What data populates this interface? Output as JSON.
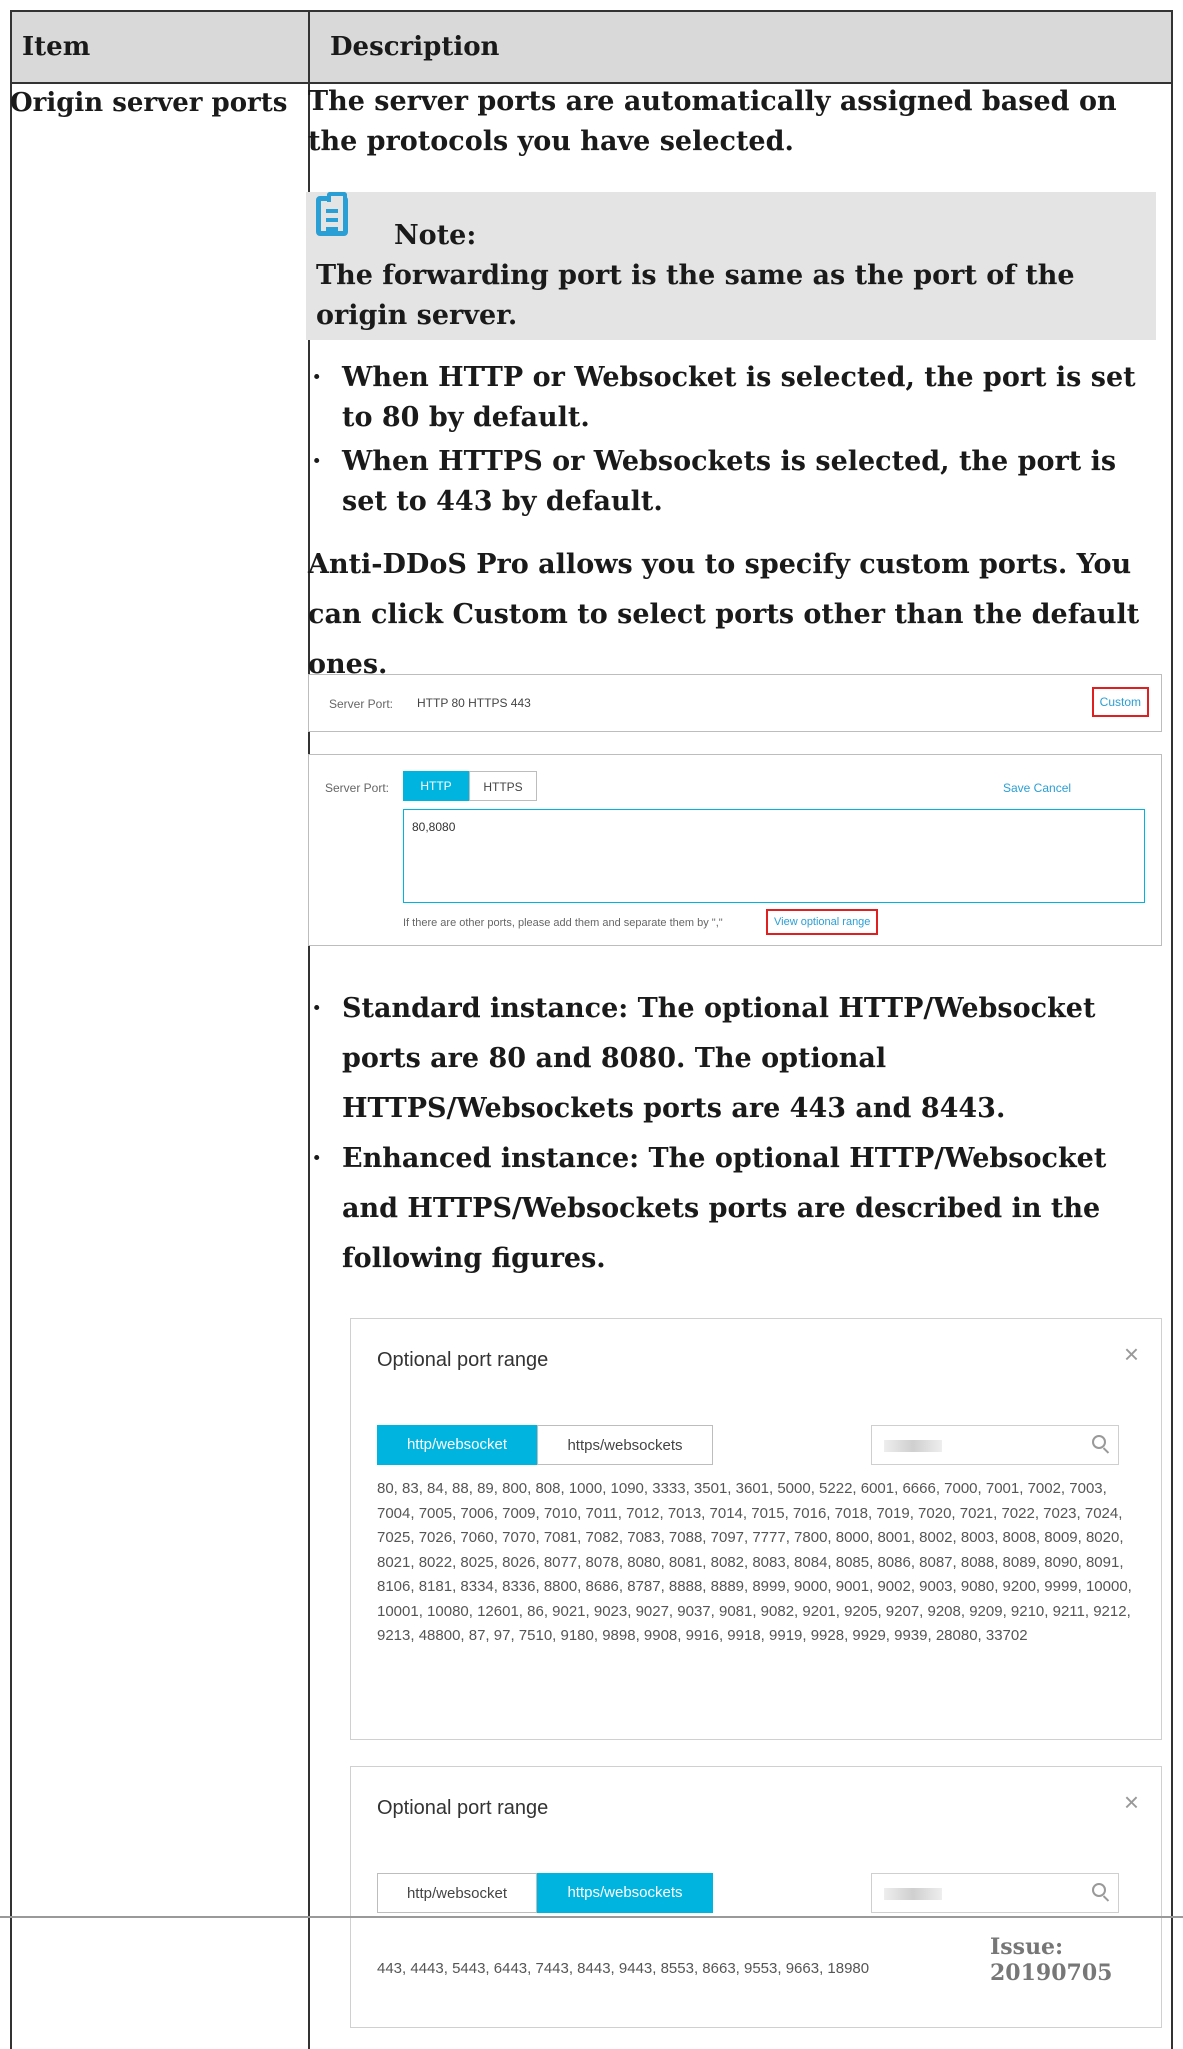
{
  "table": {
    "headers": [
      "Item",
      "Description"
    ],
    "item": "Origin server ports",
    "intro": "The server ports are automatically assigned based on the protocols you have selected.",
    "note": {
      "title": "Note:",
      "text": "The forwarding port is the same as the port of the origin server.",
      "icon": "note-icon"
    },
    "defaults": [
      "When HTTP or Websocket is selected, the port is set to 80 by default.",
      "When HTTPS or Websockets is selected, the port is set to 443 by default."
    ],
    "custom_text": "Anti-DDoS Pro allows you to specify custom ports. You can click Custom to select ports other than the default ones.",
    "instances": [
      "Standard instance: The optional HTTP/Websocket ports are 80 and 8080. The optional HTTPS/Websockets ports are 443 and 8443.",
      "Enhanced instance: The optional HTTP/Websocket and HTTPS/Websockets ports are described in the following figures."
    ],
    "bullet": "·"
  },
  "server_port_view": {
    "label": "Server Port:",
    "value": "HTTP 80   HTTPS 443",
    "custom": "Custom"
  },
  "server_port_edit": {
    "label": "Server Port:",
    "tabs": [
      "HTTP",
      "HTTPS"
    ],
    "actions": "Save Cancel",
    "ports_value": "80,8080",
    "hint": "If there are other ports, please add them and separate them by \",\"",
    "view_range": "View optional range"
  },
  "dialogs": [
    {
      "title": "Optional port range",
      "close": "×",
      "tabs": [
        "http/websocket",
        "https/websockets"
      ],
      "active_tab": 0,
      "ports": "80, 83, 84, 88, 89, 800, 808, 1000, 1090, 3333, 3501, 3601, 5000, 5222, 6001, 6666, 7000, 7001, 7002, 7003, 7004, 7005, 7006, 7009, 7010, 7011, 7012, 7013, 7014, 7015, 7016, 7018, 7019, 7020, 7021, 7022, 7023, 7024, 7025, 7026, 7060, 7070, 7081, 7082, 7083, 7088, 7097, 7777, 7800, 8000, 8001, 8002, 8003, 8008, 8009, 8020, 8021, 8022, 8025, 8026, 8077, 8078, 8080, 8081, 8082, 8083, 8084, 8085, 8086, 8087, 8088, 8089, 8090, 8091, 8106, 8181, 8334, 8336, 8800, 8686, 8787, 8888, 8889, 8999, 9000, 9001, 9002, 9003, 9080, 9200, 9999, 10000, 10001, 10080, 12601, 86, 9021, 9023, 9027, 9037, 9081, 9082, 9201, 9205, 9207, 9208, 9209, 9210, 9211, 9212, 9213, 48800, 87, 97, 7510, 9180, 9898, 9908, 9916, 9918, 9919, 9928, 9929, 9939, 28080, 33702"
    },
    {
      "title": "Optional port range",
      "close": "×",
      "tabs": [
        "http/websocket",
        "https/websockets"
      ],
      "active_tab": 1,
      "ports": "443, 4443, 5443, 6443, 7443, 8443, 9443, 8553, 8663, 9553, 9663, 18980"
    }
  ],
  "footer": {
    "issue": "Issue: 20190705"
  },
  "colors": {
    "accent": "#00b4e0",
    "link": "#2a9fd6",
    "highlight_box": "#e02020",
    "header_bg": "#d9d9d9",
    "note_bg": "#e4e4e4"
  }
}
